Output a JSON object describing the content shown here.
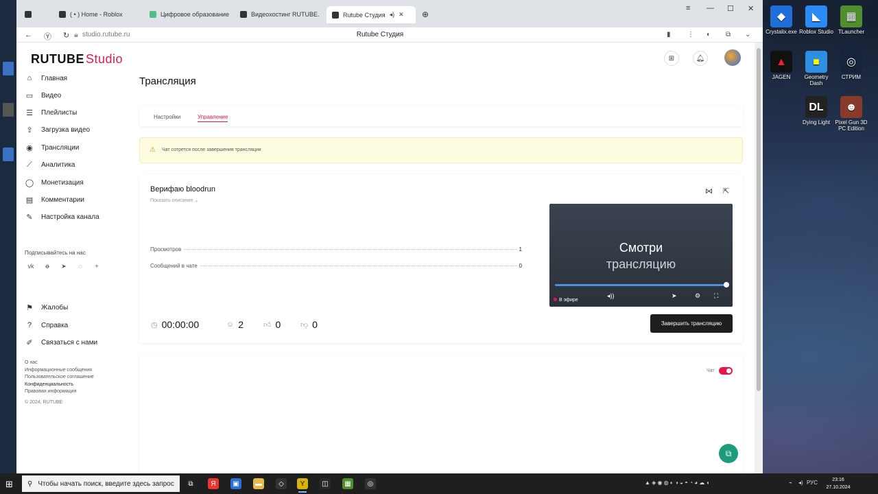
{
  "browser": {
    "tabs": [
      {
        "label": "( • ) Home - Roblox"
      },
      {
        "label": "Цифровое образование"
      },
      {
        "label": "Видеохостинг RUTUBE. С"
      },
      {
        "label": "Rutube Студия"
      }
    ],
    "url": "studio.rutube.ru",
    "page_title": "Rutube Студия"
  },
  "desktop_icons": [
    {
      "label": "Crystalix.exe"
    },
    {
      "label": "Roblox Studio"
    },
    {
      "label": "TLauncher"
    },
    {
      "label": "JAGEN"
    },
    {
      "label": "Geometry Dash"
    },
    {
      "label": "СТРИМ"
    },
    {
      "label": "Dying Light"
    },
    {
      "label": "Pixel Gun 3D PC Edition"
    }
  ],
  "studio": {
    "logo_main": "RUTUBE",
    "logo_studio": "Studio",
    "sidebar": {
      "items": [
        {
          "label": "Главная",
          "icon": "home-icon"
        },
        {
          "label": "Видео",
          "icon": "video-icon"
        },
        {
          "label": "Плейлисты",
          "icon": "playlist-icon"
        },
        {
          "label": "Загрузка видео",
          "icon": "upload-icon"
        },
        {
          "label": "Трансляции",
          "icon": "broadcast-icon"
        },
        {
          "label": "Аналитика",
          "icon": "analytics-icon"
        },
        {
          "label": "Монетизация",
          "icon": "monetization-icon"
        },
        {
          "label": "Комментарии",
          "icon": "comments-icon"
        },
        {
          "label": "Настройка канала",
          "icon": "channel-settings-icon"
        }
      ],
      "subscribe_label": "Подписывайтесь на нас",
      "bottom_items": [
        {
          "label": "Жалобы",
          "icon": "flag-icon"
        },
        {
          "label": "Справка",
          "icon": "help-icon"
        },
        {
          "label": "Связаться с нами",
          "icon": "contact-icon"
        }
      ],
      "footer_links": [
        "О нас",
        "Информационные сообщения",
        "Пользовательское соглашение",
        "Конфиденциальность",
        "Правовая информация"
      ],
      "copyright": "© 2024, RUTUBE"
    },
    "page_heading": "Трансляция",
    "tabs": {
      "settings": "Настройки",
      "management": "Управление"
    },
    "warning": "Чат сотрется после завершения трансляции",
    "stream": {
      "title": "Верифаю bloodrun",
      "show_description": "Показать описание",
      "stats": [
        {
          "label": "Просмотров",
          "value": "1"
        },
        {
          "label": "Сообщений в чате",
          "value": "0"
        }
      ],
      "duration": "00:00:00",
      "viewers": "2",
      "likes": "0",
      "dislikes": "0"
    },
    "player": {
      "line1": "Смотри",
      "line2": "трансляцию",
      "live_label": "В эфире",
      "progress": 1.0
    },
    "end_button": "Завершить трансляцию",
    "chat_toggle_label": "Чат",
    "chat_enabled": true
  },
  "taskbar": {
    "search_placeholder": "Чтобы начать поиск, введите здесь запрос",
    "lang": "РУС",
    "time": "23:16",
    "date": "27.10.2024"
  },
  "colors": {
    "accent": "#e4184a",
    "warning_bg": "#fdfbe0",
    "fab": "#1d9b7a"
  }
}
